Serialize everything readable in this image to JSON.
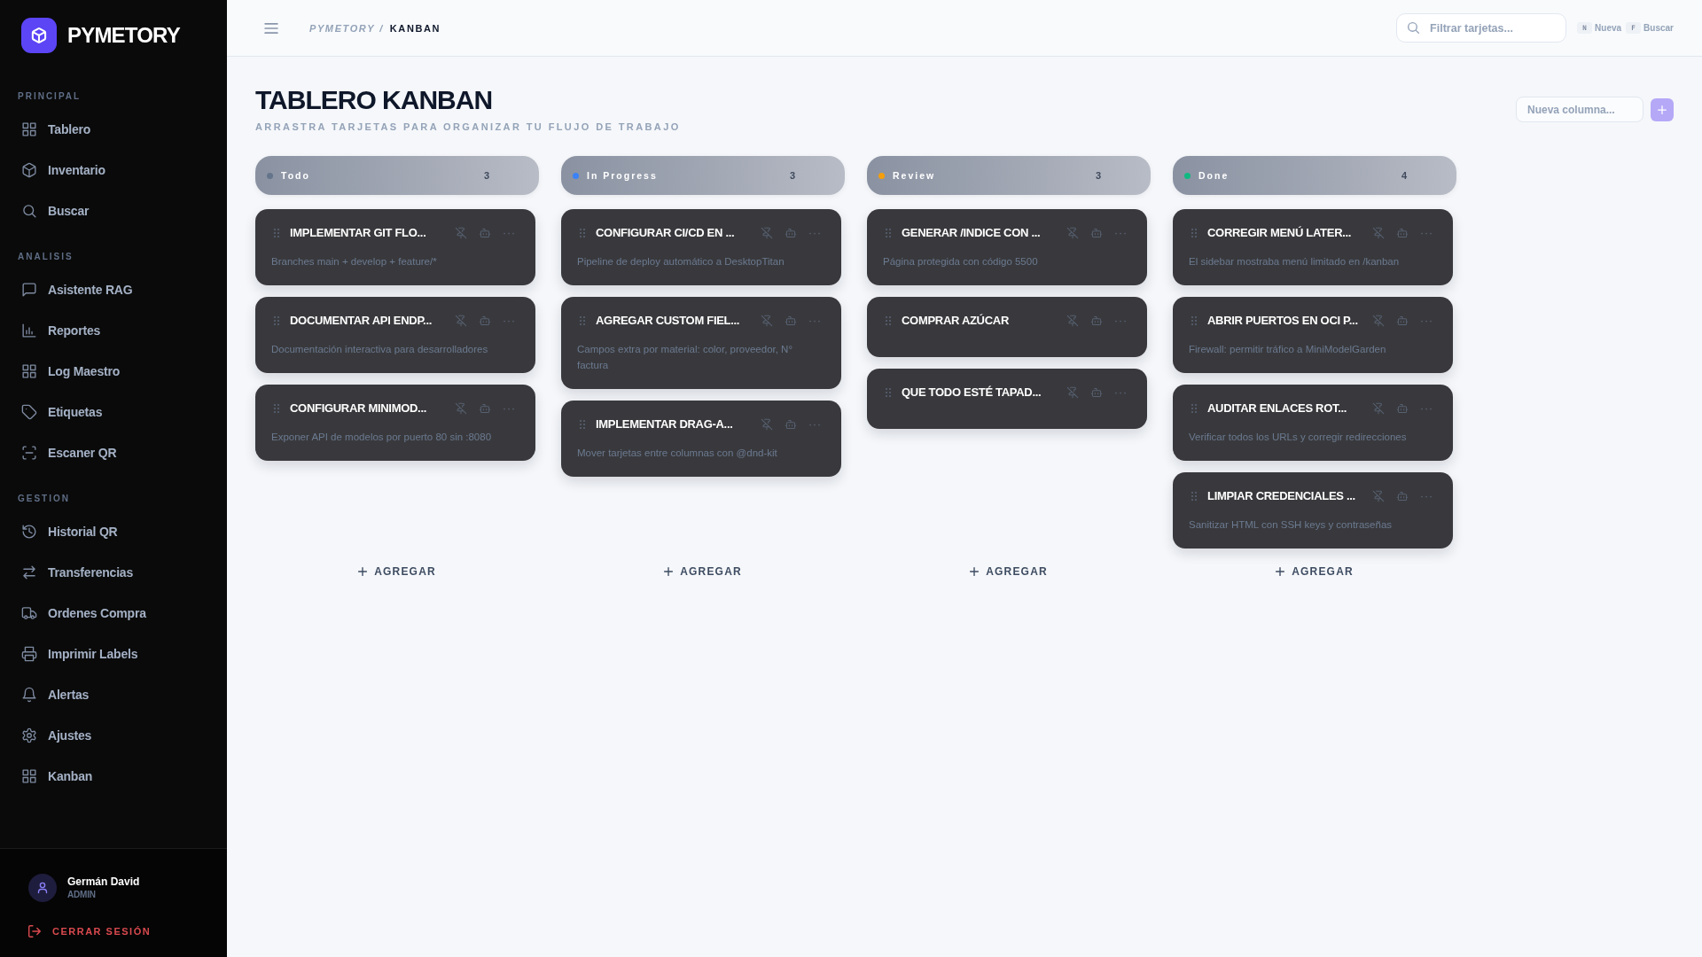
{
  "sidebar": {
    "brand": "PYMETORY",
    "sections": [
      {
        "label": "PRINCIPAL",
        "items": [
          {
            "label": "Tablero",
            "selected": false
          },
          {
            "label": "Inventario",
            "selected": false
          },
          {
            "label": "Buscar",
            "selected": false
          }
        ]
      },
      {
        "label": "ANALISIS",
        "items": [
          {
            "label": "Asistente RAG",
            "selected": false
          },
          {
            "label": "Reportes",
            "selected": false
          },
          {
            "label": "Log Maestro",
            "selected": false
          },
          {
            "label": "Etiquetas",
            "selected": false
          },
          {
            "label": "Escaner QR",
            "selected": false
          }
        ]
      },
      {
        "label": "GESTION",
        "items": [
          {
            "label": "Historial QR",
            "selected": false
          },
          {
            "label": "Transferencias",
            "selected": false
          },
          {
            "label": "Ordenes Compra",
            "selected": false
          },
          {
            "label": "Imprimir Labels",
            "selected": false
          },
          {
            "label": "Alertas",
            "selected": false
          },
          {
            "label": "Ajustes",
            "selected": false
          },
          {
            "label": "Kanban",
            "selected": false
          }
        ]
      }
    ],
    "user": {
      "name": "Germán David",
      "role": "ADMIN"
    },
    "logout": "CERRAR SESIÓN"
  },
  "topbar": {
    "breadcrumb": [
      "PYMETORY",
      "KANBAN"
    ],
    "breadcrumb_separator": "/",
    "search": {
      "placeholder": "Filtrar tarjetas..."
    },
    "shortcuts": [
      {
        "key": "N",
        "label": "Nueva"
      },
      {
        "key": "F",
        "label": "Buscar"
      }
    ]
  },
  "board": {
    "title": "TABLERO KANBAN",
    "subtitle": "ARRASTRA TARJETAS PARA ORGANIZAR TU FLUJO DE TRABAJO",
    "new_column": {
      "placeholder": "Nueva columna...",
      "add_disabled": true
    },
    "columns": [
      {
        "title": "Todo",
        "color": "#64748b",
        "count": "3",
        "add_label": "AGREGAR",
        "cards": [
          {
            "title": "IMPLEMENTAR GIT FLO...",
            "description": "Branches main + develop + feature/*"
          },
          {
            "title": "DOCUMENTAR API ENDP...",
            "description": "Documentación interactiva para desarrolladores"
          },
          {
            "title": "CONFIGURAR MINIMOD...",
            "description": "Exponer API de modelos por puerto 80 sin :8080"
          }
        ]
      },
      {
        "title": "In Progress",
        "color": "#3b82f6",
        "count": "3",
        "add_label": "AGREGAR",
        "cards": [
          {
            "title": "CONFIGURAR CI/CD EN ...",
            "description": "Pipeline de deploy automático a DesktopTitan"
          },
          {
            "title": "AGREGAR CUSTOM FIEL...",
            "description": "Campos extra por material: color, proveedor, N° factura"
          },
          {
            "title": "IMPLEMENTAR DRAG-A...",
            "description": "Mover tarjetas entre columnas con @dnd-kit"
          }
        ]
      },
      {
        "title": "Review",
        "color": "#f59e0b",
        "count": "3",
        "add_label": "AGREGAR",
        "cards": [
          {
            "title": "GENERAR /INDICE CON ...",
            "description": "Página protegida con código 5500"
          },
          {
            "title": "COMPRAR AZÚCAR"
          },
          {
            "title": "QUE TODO ESTÉ TAPAD..."
          }
        ]
      },
      {
        "title": "Done",
        "color": "#10b981",
        "count": "4",
        "add_label": "AGREGAR",
        "cards": [
          {
            "title": "CORREGIR MENÚ LATER...",
            "description": "El sidebar mostraba menú limitado en /kanban"
          },
          {
            "title": "ABRIR PUERTOS EN OCI P...",
            "description": "Firewall: permitir tráfico a MiniModelGarden"
          },
          {
            "title": "AUDITAR ENLACES ROT...",
            "description": "Verificar todos los URLs y corregir redirecciones"
          },
          {
            "title": "LIMPIAR CREDENCIALES ...",
            "description": "Sanitizar HTML con SSH keys y contraseñas"
          }
        ]
      }
    ]
  }
}
